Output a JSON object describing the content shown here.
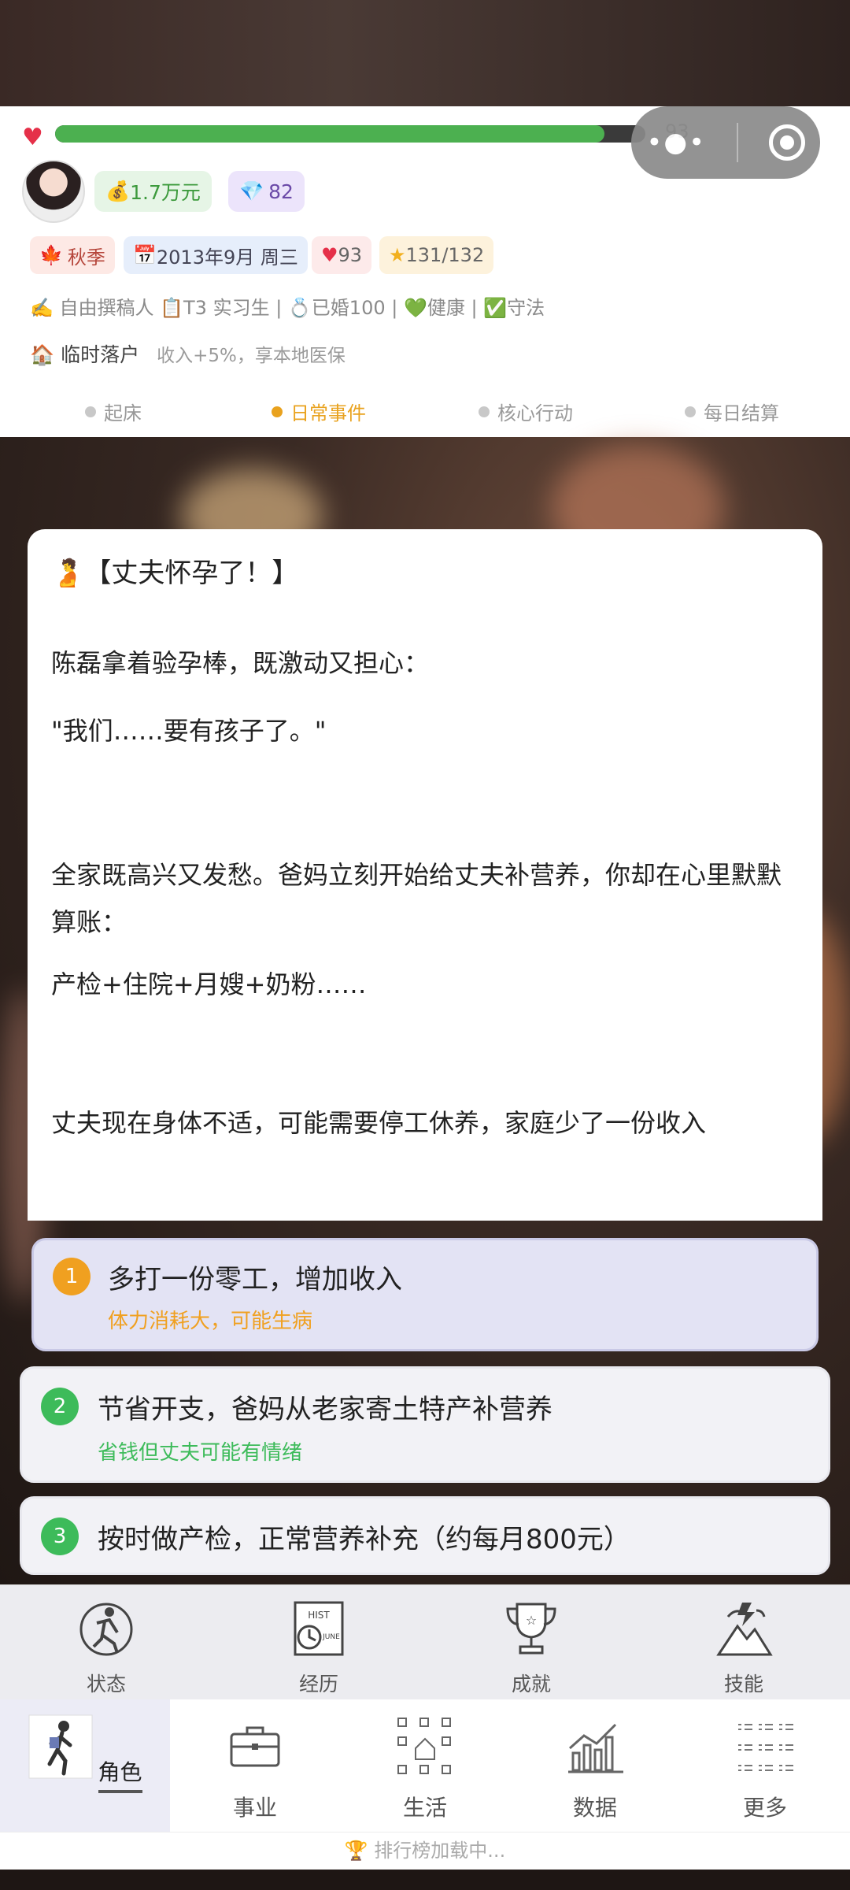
{
  "status": {
    "hp_value": "93",
    "hp_fraction": 0.93,
    "money": "1.7万元",
    "diamonds": "82",
    "season": "秋季",
    "date": "2013年9月 周三",
    "health": "93",
    "stars": "131/132",
    "info_line": "✍️ 自由撰稿人 📋T3 实习生 | 💍已婚100 | 💚健康 | ✅守法",
    "housing_label": "临时落户",
    "housing_desc": "收入+5%，享本地医保"
  },
  "phases": [
    {
      "label": "起床",
      "active": false
    },
    {
      "label": "日常事件",
      "active": true
    },
    {
      "label": "核心行动",
      "active": false
    },
    {
      "label": "每日结算",
      "active": false
    }
  ],
  "story": {
    "title": "【丈夫怀孕了！】",
    "paragraphs": [
      "陈磊拿着验孕棒，既激动又担心：",
      "\"我们……要有孩子了。\"",
      "全家既高兴又发愁。爸妈立刻开始给丈夫补营养，你却在心里默默算账：",
      "产检+住院+月嫂+奶粉……",
      "丈夫现在身体不适，可能需要停工休养，家庭少了一份收入"
    ]
  },
  "options": [
    {
      "num": "1",
      "text": "多打一份零工，增加收入",
      "hint": "体力消耗大，可能生病",
      "color": "#f0a020"
    },
    {
      "num": "2",
      "text": "节省开支，爸妈从老家寄土特产补营养",
      "hint": "省钱但丈夫可能有情绪",
      "color": "#3dbb5a"
    },
    {
      "num": "3",
      "text": "按时做产检，正常营养补充（约每月800元）",
      "hint": "",
      "color": "#3dbb5a"
    }
  ],
  "tools": [
    {
      "label": "状态",
      "icon": "status-icon"
    },
    {
      "label": "经历",
      "icon": "history-icon"
    },
    {
      "label": "成就",
      "icon": "trophy-icon"
    },
    {
      "label": "技能",
      "icon": "skill-icon"
    }
  ],
  "nav": [
    {
      "label": "角色",
      "icon": "character-icon",
      "active": true
    },
    {
      "label": "事业",
      "icon": "briefcase-icon",
      "active": false
    },
    {
      "label": "生活",
      "icon": "life-icon",
      "active": false
    },
    {
      "label": "数据",
      "icon": "chart-icon",
      "active": false
    },
    {
      "label": "更多",
      "icon": "more-icon",
      "active": false
    }
  ],
  "rank_text": "🏆 排行榜加载中...",
  "colors": {
    "hp": "#4cb050",
    "active_phase": "#e9a21e",
    "hint_orange": "#f0a020",
    "hint_green": "#3dbb5a"
  }
}
